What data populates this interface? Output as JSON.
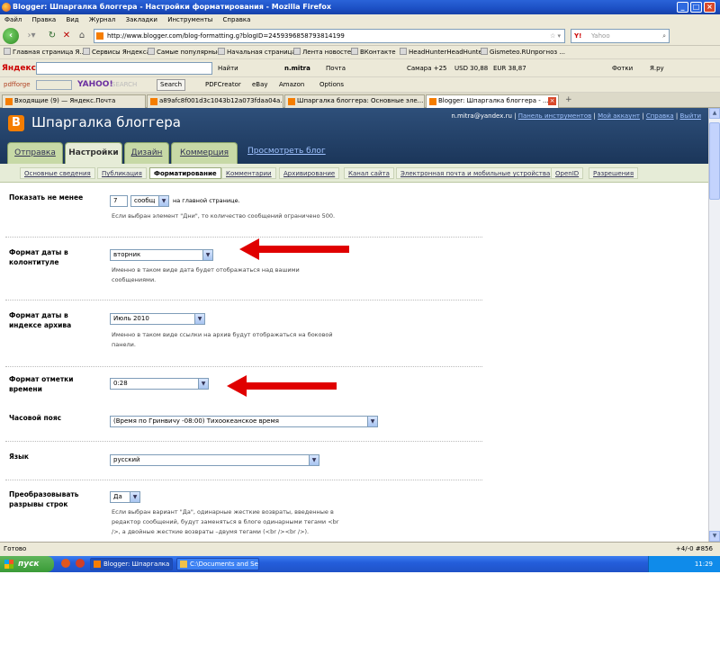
{
  "window": {
    "title": "Blogger: Шпаргалка блоггера - Настройки форматирования - Mozilla Firefox"
  },
  "menu": [
    "Файл",
    "Правка",
    "Вид",
    "Журнал",
    "Закладки",
    "Инструменты",
    "Справка"
  ],
  "nav": {
    "url": "http://www.blogger.com/blog-formatting.g?blogID=2459396858793814199",
    "search_placeholder": "Yahoo"
  },
  "bookmarks": [
    "Главная страница Я...",
    "Сервисы Яндекса",
    "Самые популярные",
    "Начальная страница",
    "Лента новостей",
    "ВКонтакте",
    "HeadHunterHeadHunter",
    "Gismeteo.RUпрогноз ..."
  ],
  "yandex_bar": {
    "logo": "Яндекс",
    "find": "Найти",
    "mail_user": "n.mitra",
    "mail": "Почта",
    "weather": "Самара +25",
    "usd": "USD 30,88",
    "eur": "EUR 38,87",
    "photos": "Фотки",
    "yaru": "Я.ру"
  },
  "yahoo_bar": {
    "brand": "pdfforge",
    "logo": "YAHOO!",
    "search": "SEARCH",
    "search_btn": "Search",
    "pdfcreator": "PDFCreator",
    "ebay": "eBay",
    "amazon": "Amazon",
    "options": "Options"
  },
  "browser_tabs": [
    "Входящие (9) — Яндекс.Почта",
    "a89afc8f001d3c1043b12a073fdaa04a...",
    "Шпаргалка блоггера: Основные эле...",
    "Blogger: Шпаргалка блоггера - ..."
  ],
  "blogger": {
    "title": "Шпаргалка блоггера",
    "user": "n.mitra@yandex.ru",
    "links": [
      "Панель инструментов",
      "Мой аккаунт",
      "Справка",
      "Выйти"
    ],
    "main_tabs": [
      "Отправка",
      "Настройки",
      "Дизайн",
      "Коммерция"
    ],
    "view_blog": "Просмотреть блог",
    "sub_tabs": [
      "Основные сведения",
      "Публикация",
      "Форматирование",
      "Комментарии",
      "Архивирование",
      "Канал сайта",
      "Электронная почта и мобильные устройства",
      "OpenID",
      "Разрешения"
    ]
  },
  "settings": {
    "show_label": "Показать не менее",
    "show_count": "7",
    "show_unit": "сообщ",
    "show_suffix": "на главной странице.",
    "show_hint": "Если выбран элемент \"Дни\", то количество сообщений ограничено 500.",
    "date_header_label": "Формат даты в колонтитуле",
    "date_header_value": "вторник",
    "date_header_hint": "Именно в таком виде дата будет отображаться над вашими сообщениями.",
    "archive_label": "Формат даты в индексе архива",
    "archive_value": "Июль 2010",
    "archive_hint": "Именно в таком виде ссылки на архив будут отображаться на боковой панели.",
    "timestamp_label": "Формат отметки времени",
    "timestamp_value": "0:28",
    "timezone_label": "Часовой пояс",
    "timezone_value": "(Время по Гринвичу -08:00) Тихоокеанское время",
    "language_label": "Язык",
    "language_value": "русский",
    "linebreak_label": "Преобразовывать разрывы строк",
    "linebreak_value": "Да",
    "linebreak_hint": "Если выбран вариант \"Да\", одинарные жесткие возвраты, введенные в редактор сообщений, будут заменяться в блоге одинарными тегами <br />, а двойные жесткие возвраты –двумя тегами (<br /><br />)."
  },
  "status": {
    "text": "Готово",
    "right": "+4/-0  #856"
  },
  "taskbar": {
    "start": "пуск",
    "tasks": [
      "Blogger: Шпаргалка ...",
      "C:\\Documents and Se..."
    ],
    "clock": "11:29"
  },
  "colors": {
    "arrow": "#e00000",
    "header": "#1f3a60",
    "accent": "#f57d00"
  }
}
